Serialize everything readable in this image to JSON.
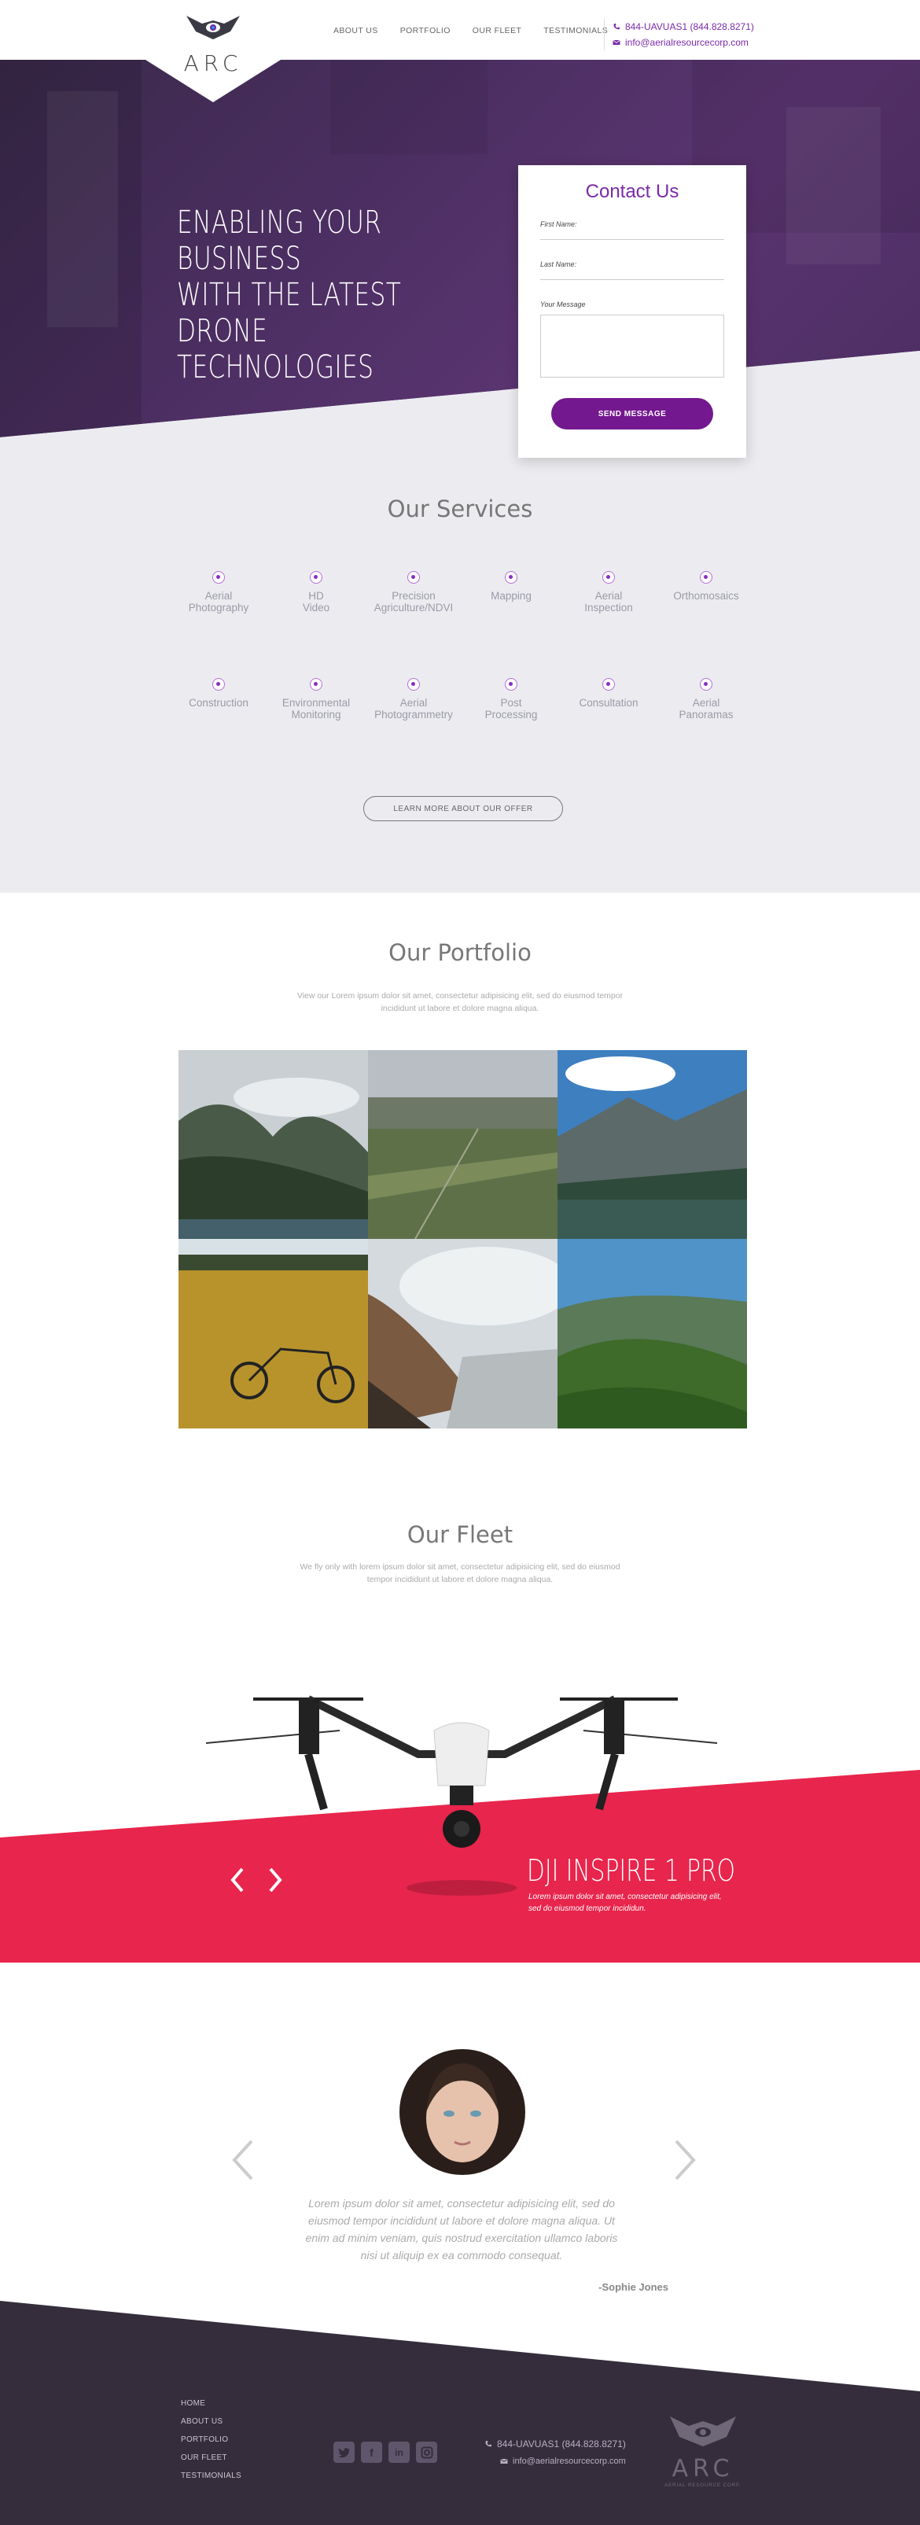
{
  "brand": {
    "name": "ARC",
    "footer_tagline": "AERIAL RESOURCE CORP."
  },
  "nav": {
    "items": [
      "ABOUT US",
      "PORTFOLIO",
      "OUR FLEET",
      "TESTIMONIALS"
    ]
  },
  "contact": {
    "phone": "844-UAVUAS1 (844.828.8271)",
    "email": "info@aerialresourcecorp.com"
  },
  "hero": {
    "title_lines": [
      "ENABLING YOUR BUSINESS",
      "WITH THE LATEST",
      "DRONE TECHNOLOGIES"
    ]
  },
  "contact_form": {
    "title": "Contact Us",
    "first_name_label": "First Name:",
    "last_name_label": "Last Name:",
    "message_label": "Your Message",
    "submit_label": "SEND MESSAGE"
  },
  "services": {
    "title": "Our Services",
    "items": [
      [
        "Aerial",
        "Photography"
      ],
      [
        "HD",
        "Video"
      ],
      [
        "Precision",
        "Agriculture/NDVI"
      ],
      [
        "Mapping"
      ],
      [
        "Aerial",
        "Inspection"
      ],
      [
        "Orthomosaics"
      ],
      [
        "Construction"
      ],
      [
        "Environmental",
        "Monitoring"
      ],
      [
        "Aerial",
        "Photogrammetry"
      ],
      [
        "Post",
        "Processing"
      ],
      [
        "Consultation"
      ],
      [
        "Aerial",
        "Panoramas"
      ]
    ],
    "cta": "LEARN MORE ABOUT OUR OFFER"
  },
  "portfolio": {
    "title": "Our Portfolio",
    "subtitle_lines": [
      "View our Lorem ipsum dolor sit amet, consectetur adipisicing elit, sed do eiusmod tempor",
      "incididunt ut labore et dolore magna aliqua."
    ]
  },
  "fleet": {
    "title": "Our Fleet",
    "subtitle_lines": [
      "We fly only with lorem ipsum dolor sit amet, consectetur adipisicing elit, sed do eiusmod",
      "tempor incididunt ut labore et dolore magna aliqua."
    ],
    "drone_name": "DJI INSPIRE 1 PRO",
    "drone_desc": "Lorem ipsum dolor sit amet, consectetur adipisicing elit, sed do eiusmod tempor incididun."
  },
  "testimonial": {
    "quote": "Lorem ipsum dolor sit amet, consectetur adipisicing elit, sed do eiusmod tempor incididunt ut labore et dolore magna aliqua. Ut enim ad minim veniam, quis nostrud exercitation ullamco laboris nisi ut aliquip ex ea commodo consequat.",
    "author": "-Sophie Jones"
  },
  "footer": {
    "links": [
      "HOME",
      "ABOUT US",
      "PORTFOLIO",
      "OUR FLEET",
      "TESTIMONIALS"
    ],
    "socials": [
      "twitter-icon",
      "facebook-icon",
      "linkedin-icon",
      "instagram-icon"
    ]
  },
  "colors": {
    "accent": "#74188f",
    "fleet_red": "#e8254c",
    "footer": "#352d3c"
  }
}
